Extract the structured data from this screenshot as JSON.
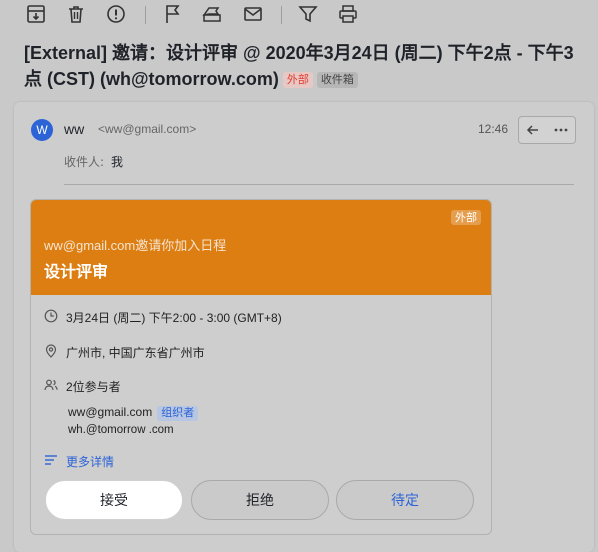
{
  "toolbar": {
    "icons": [
      "archive-icon",
      "trash-icon",
      "spam-icon",
      "flag-icon",
      "label-icon",
      "mark-unread-icon",
      "filter-icon",
      "print-icon"
    ]
  },
  "subject": {
    "text": "[External] 邀请：设计评审 @ 2020年3月24日 (周二) 下午2点 - 下午3点 (CST) (wh@tomorrow.com)",
    "external_tag": "外部",
    "folder_tag": "收件箱"
  },
  "message": {
    "avatar_letter": "W",
    "sender_name": "ww",
    "sender_email": "<ww@gmail.com>",
    "time": "12:46",
    "recipients_label": "收件人:",
    "recipients_value": "我"
  },
  "invite": {
    "badge": "外部",
    "subtitle": "ww@gmail.com邀请你加入日程",
    "title": "设计评审",
    "datetime": "3月24日 (周二) 下午2:00 - 3:00 (GMT+8)",
    "location": "广州市, 中国广东省广州市",
    "attendee_count": "2位参与者",
    "attendees": [
      {
        "email": "ww@gmail.com",
        "tag": "组织者"
      },
      {
        "email": "wh.@tomorrow .com",
        "tag": ""
      }
    ],
    "more_details": "更多详情",
    "actions": {
      "accept": "接受",
      "decline": "拒绝",
      "tentative": "待定"
    }
  },
  "colors": {
    "header_orange": "#dd7e12",
    "link_blue": "#2c63d6",
    "external_red": "#e23b30"
  }
}
